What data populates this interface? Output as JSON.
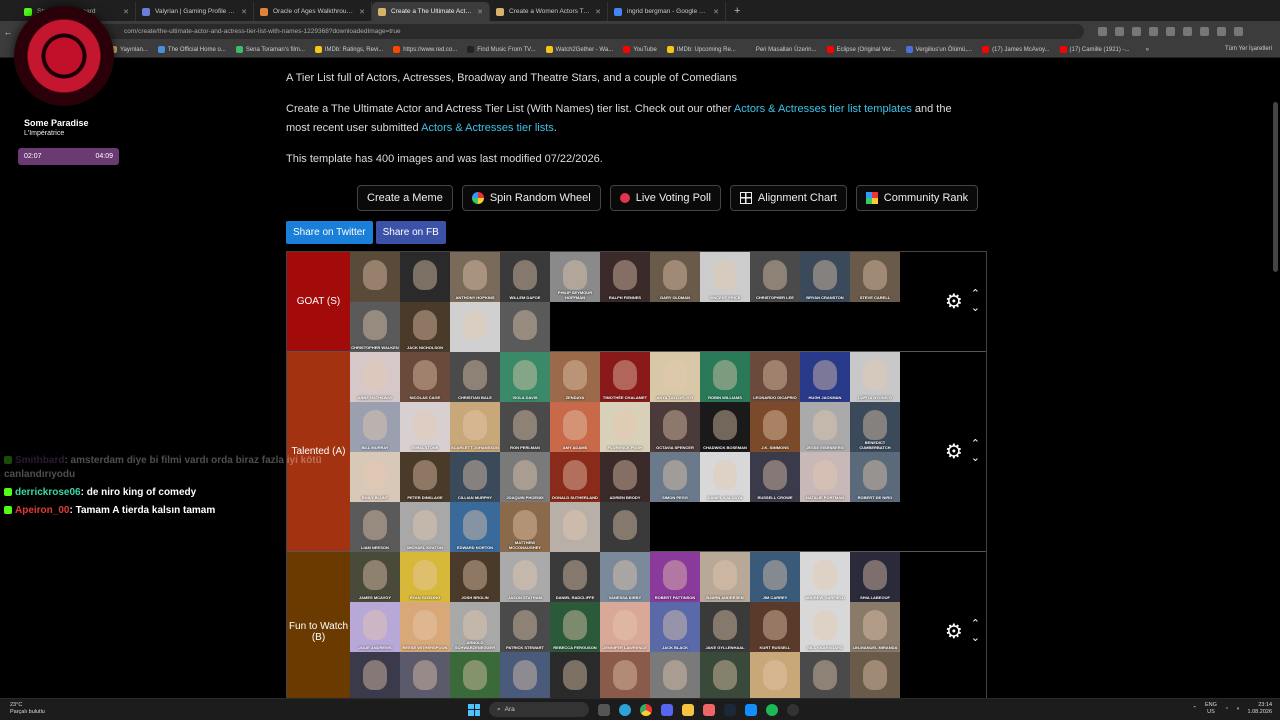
{
  "browser": {
    "tabs": [
      {
        "label": "Stream - Dashboard",
        "color": "#53fc18"
      },
      {
        "label": "Valyrian | Gaming Profile & Re",
        "color": "#6a7dd8"
      },
      {
        "label": "Oracle of Ages Walkthrough - ",
        "color": "#e0833a"
      },
      {
        "label": "Create a The Ultimate Actor an",
        "color": "#d8b26a",
        "active": true
      },
      {
        "label": "Create a Women Actors Tier Lis",
        "color": "#d8b26a"
      },
      {
        "label": "ingrid bergman - Google Search",
        "color": "#4285f4"
      }
    ],
    "new_tab": "+",
    "url": "com/create/the-ultimate-actor-and-actress-tier-list-with-names-1229368?downloadedImage=true",
    "bookmarks": [
      {
        "label": "Yayınlan...",
        "color": "#d8b26a"
      },
      {
        "label": "The Official Home o...",
        "color": "#4a90d9"
      },
      {
        "label": "Sena Toraman's film...",
        "color": "#3dbb68"
      },
      {
        "label": "IMDb: Ratings, Revi...",
        "color": "#f5c518"
      },
      {
        "label": "https://www.red.co...",
        "color": "#ff4500"
      },
      {
        "label": "Find Music From TV...",
        "color": "#222222"
      },
      {
        "label": "Watch2Gether - Wa...",
        "color": "#f5c518"
      },
      {
        "label": "YouTube",
        "color": "#ff0000"
      },
      {
        "label": "IMDb: Upcoming Re...",
        "color": "#f5c518"
      },
      {
        "label": "Peri Masalları Üzerin...",
        "color": "#3c3c3c"
      },
      {
        "label": "Eclipse (Original Ver...",
        "color": "#ff0000"
      },
      {
        "label": "Vergilius'un Ölümü,...",
        "color": "#4a70d9"
      },
      {
        "label": "(17) James McAvoy...",
        "color": "#ff0000"
      },
      {
        "label": "(17) Camille (1921) -...",
        "color": "#ff0000"
      }
    ],
    "bookmarks_more": "»",
    "bookmarks_all": "Tüm Yer İşaretleri"
  },
  "page": {
    "subtitle": "A Tier List full of Actors, Actresses, Broadway and Theatre Stars, and a couple of Comedians",
    "desc_part1": "Create a The Ultimate Actor and Actress Tier List (With Names) tier list. Check out our other ",
    "desc_link1": "Actors & Actresses tier list templates",
    "desc_part2": " and the most recent user submitted ",
    "desc_link2": "Actors & Actresses tier lists",
    "desc_part3": ".",
    "template_info": "This template has 400 images and was last modified 07/22/2026.",
    "buttons": {
      "meme": "Create a Meme",
      "wheel": "Spin Random Wheel",
      "poll": "Live Voting Poll",
      "alignment": "Alignment Chart",
      "community": "Community Rank"
    },
    "share_twitter": "Share on Twitter",
    "share_fb": "Share on FB"
  },
  "tiers": [
    {
      "label": "GOAT (S)",
      "color": "#a30a0a",
      "items": [
        {
          "name": "",
          "color": "#5a4a3a"
        },
        {
          "name": "",
          "color": "#2a2a2a"
        },
        {
          "name": "ANTHONY HOPKINS",
          "color": "#7a6a5a"
        },
        {
          "name": "WILLEM DAFOE",
          "color": "#3a3a3a"
        },
        {
          "name": "PHILIP SEYMOUR HOFFMAN",
          "color": "#8a8a8a"
        },
        {
          "name": "RALPH FIENNES",
          "color": "#3a2a2a"
        },
        {
          "name": "GARY OLDMAN",
          "color": "#6a5a4a"
        },
        {
          "name": "VINCENT PRICE",
          "color": "#cccccc"
        },
        {
          "name": "CHRISTOPHER LEE",
          "color": "#4a4a4a"
        },
        {
          "name": "BRYAN CRANSTON",
          "color": "#3a4a5a"
        },
        {
          "name": "STEVE CARELL",
          "color": "#6a5a4a"
        },
        {
          "name": "CHRISTOPHER WALKEN",
          "color": "#5a5a5a"
        },
        {
          "name": "JACK NICHOLSON",
          "color": "#4a3a2a"
        },
        {
          "name": "",
          "color": "#d0d0d0"
        },
        {
          "name": "",
          "color": "#5a5a5a"
        }
      ]
    },
    {
      "label": "Talented (A)",
      "color": "#a33210",
      "items": [
        {
          "name": "ANNE HATHAWAY",
          "color": "#d6c8c8"
        },
        {
          "name": "NICOLAS CAGE",
          "color": "#6a4a3a"
        },
        {
          "name": "CHRISTIAN BALE",
          "color": "#4a4a4a"
        },
        {
          "name": "VIOLA DAVIS",
          "color": "#3a8a6a"
        },
        {
          "name": "ZENDAYA",
          "color": "#9a6a4a"
        },
        {
          "name": "TIMOTHÉE CHALAMET",
          "color": "#8a1a1a"
        },
        {
          "name": "ANYA TAYLOR-JOY",
          "color": "#d8c8a8"
        },
        {
          "name": "ROBIN WILLIAMS",
          "color": "#2a7a5a"
        },
        {
          "name": "LEONARDO DICAPRIO",
          "color": "#6a4a3a"
        },
        {
          "name": "HUGH JACKMAN",
          "color": "#2a3a8a"
        },
        {
          "name": "LUPITA NYONG'O",
          "color": "#c8c8c8"
        },
        {
          "name": "BILL MURRAY",
          "color": "#9aa0b0"
        },
        {
          "name": "EMMA STONE",
          "color": "#d8d0d0"
        },
        {
          "name": "SCARLETT JOHANSSON",
          "color": "#c8a878"
        },
        {
          "name": "RON PERLMAN",
          "color": "#4a4a4a"
        },
        {
          "name": "AMY ADAMS",
          "color": "#c86a4a"
        },
        {
          "name": "FLORENCE PUGH",
          "color": "#d8d0b8"
        },
        {
          "name": "OCTAVIA SPENCER",
          "color": "#4a3a3a"
        },
        {
          "name": "CHADWICK BOSEMAN",
          "color": "#1a1a1a"
        },
        {
          "name": "J.K. SIMMONS",
          "color": "#7a4a2a"
        },
        {
          "name": "JESSE EISENBERG",
          "color": "#aaaaaa"
        },
        {
          "name": "BENEDICT CUMBERBATCH",
          "color": "#3a4a5a"
        },
        {
          "name": "EMILY BLUNT",
          "color": "#d8c8b8"
        },
        {
          "name": "PETER DINKLAGE",
          "color": "#4a3a2a"
        },
        {
          "name": "CILLIAN MURPHY",
          "color": "#3a4a5a"
        },
        {
          "name": "JOAQUIN PHOENIX",
          "color": "#7a7a7a"
        },
        {
          "name": "DONALD SUTHERLAND",
          "color": "#8a2a1a"
        },
        {
          "name": "ADRIEN BRODY",
          "color": "#3a2a2a"
        },
        {
          "name": "SIMON PEGG",
          "color": "#6a7a8a"
        },
        {
          "name": "DANIEL KALUUYA",
          "color": "#d8d8d8"
        },
        {
          "name": "RUSSELL CROWE",
          "color": "#3a3a4a"
        },
        {
          "name": "NATALIE PORTMAN",
          "color": "#c8b8b8"
        },
        {
          "name": "ROBERT DE NIRO",
          "color": "#5a6a7a"
        },
        {
          "name": "LIAM NEESON",
          "color": "#5a5a5a"
        },
        {
          "name": "MICHAEL KEATON",
          "color": "#a8a8a8"
        },
        {
          "name": "EDWARD NORTON",
          "color": "#3a6a9a"
        },
        {
          "name": "MATTHEW MCCONAUGHEY",
          "color": "#8a6a4a"
        },
        {
          "name": "",
          "color": "#b8b0a8"
        },
        {
          "name": "",
          "color": "#3a3a3a"
        }
      ]
    },
    {
      "label": "Fun to Watch (B)",
      "color": "#6b3a00",
      "items": [
        {
          "name": "JAMES MCAVOY",
          "color": "#4a4a3a"
        },
        {
          "name": "RYAN GOSLING",
          "color": "#d8b838"
        },
        {
          "name": "JOSH BROLIN",
          "color": "#4a3a2a"
        },
        {
          "name": "JASON STATHAM",
          "color": "#aaaaaa"
        },
        {
          "name": "DANIEL RADCLIFFE",
          "color": "#3a3a3a"
        },
        {
          "name": "VANESSA KIRBY",
          "color": "#7a8a9a"
        },
        {
          "name": "ROBERT PATTINSON",
          "color": "#8a3a9a"
        },
        {
          "name": "BJØRN ANDRÉSEN",
          "color": "#b8a898"
        },
        {
          "name": "JIM CARREY",
          "color": "#3a5a7a"
        },
        {
          "name": "ANDREW GARFIELD",
          "color": "#d8d8d8"
        },
        {
          "name": "SHIA LABEOUF",
          "color": "#2a2a3a"
        },
        {
          "name": "JULIE ANDREWS",
          "color": "#b8a8d8"
        },
        {
          "name": "REESE WITHERSPOON",
          "color": "#d8a878"
        },
        {
          "name": "ARNOLD SCHWARZENEGGER",
          "color": "#a8a8a8"
        },
        {
          "name": "PATRICK STEWART",
          "color": "#4a4a4a"
        },
        {
          "name": "REBECCA FERGUSON",
          "color": "#2a5a3a"
        },
        {
          "name": "JENNIFER LAWRENCE",
          "color": "#d8a898"
        },
        {
          "name": "JACK BLACK",
          "color": "#5a6aa8"
        },
        {
          "name": "JAKE GYLLENHAAL",
          "color": "#3a3a3a"
        },
        {
          "name": "KURT RUSSELL",
          "color": "#5a3a2a"
        },
        {
          "name": "BILL SKARSGÅRD",
          "color": "#d8d8d8"
        },
        {
          "name": "LIN-MANUEL MIRANDA",
          "color": "#8a7a6a"
        },
        {
          "name": "",
          "color": "#3a3a4a"
        },
        {
          "name": "",
          "color": "#5a5a6a"
        },
        {
          "name": "",
          "color": "#3a6a3a"
        },
        {
          "name": "",
          "color": "#4a5a7a"
        },
        {
          "name": "",
          "color": "#2a2a2a"
        },
        {
          "name": "",
          "color": "#8a5a4a"
        },
        {
          "name": "",
          "color": "#7a7a7a"
        },
        {
          "name": "",
          "color": "#3a4a3a"
        },
        {
          "name": "",
          "color": "#c8a878"
        },
        {
          "name": "",
          "color": "#4a4a4a"
        },
        {
          "name": "",
          "color": "#6a5a4a"
        }
      ]
    }
  ],
  "music": {
    "song": "Some Paradise",
    "artist": "L'Impératrice",
    "elapsed": "02:07",
    "total": "04:09"
  },
  "chat": [
    {
      "user": "Smithbard",
      "color": "#8a5aa8",
      "msg": ": amsterdam diye bi filmi vardı orda biraz fazla iyi kötü canlandırıyodu",
      "faded": true
    },
    {
      "user": "derrickrose06",
      "color": "#3ad8a8",
      "msg": ": de niro king of comedy"
    },
    {
      "user": "Apeiron_00",
      "color": "#e03a3a",
      "msg": ": Tamam A tierda kalsın tamam"
    }
  ],
  "taskbar": {
    "temp": "23°C",
    "weather": "Parçalı bulutlu",
    "search": "Ara",
    "lang1": "ENG",
    "lang2": "US",
    "time": "23:14",
    "date": "1.08.2026"
  }
}
